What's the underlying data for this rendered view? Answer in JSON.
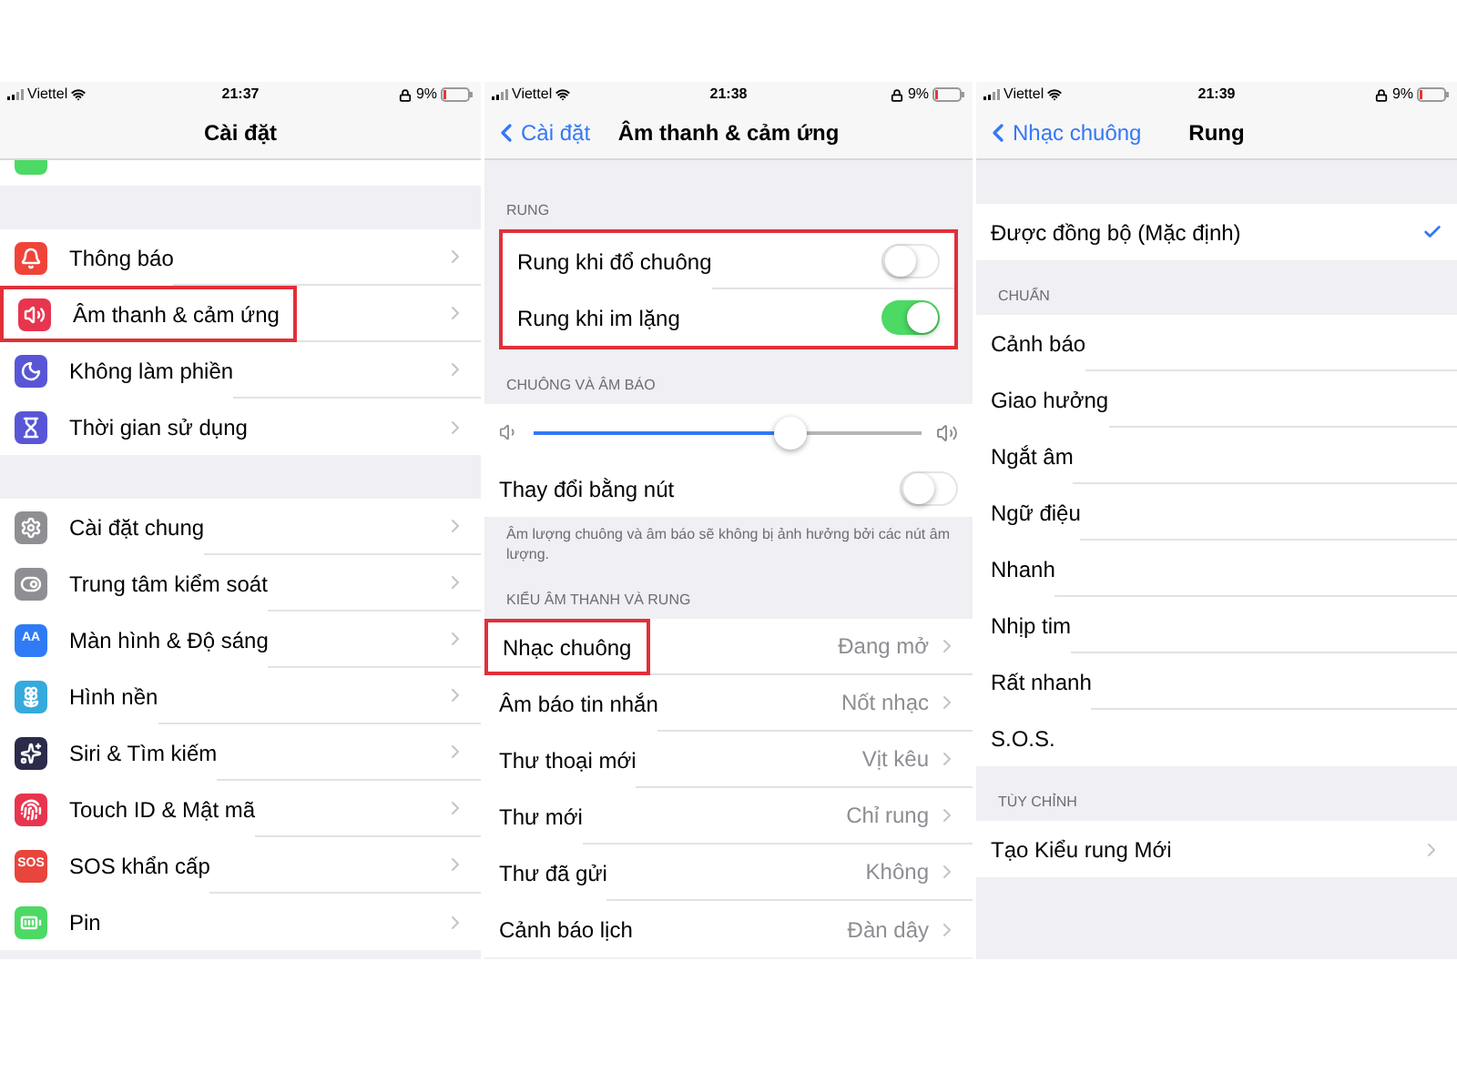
{
  "screens": [
    {
      "kind": "settings",
      "status_bar": {
        "carrier": "Viettel",
        "time": "21:37",
        "battery": "9%"
      },
      "nav": {
        "title": "Cài đặt"
      },
      "groups": [
        {
          "rows": [
            {
              "kind": "cut",
              "color": "#4cd964"
            }
          ]
        },
        {
          "rows": [
            {
              "kind": "link",
              "label": "Thông báo",
              "color": "#f0443a",
              "highlighted": false
            },
            {
              "kind": "link",
              "label": "Âm thanh & cảm ứng",
              "color": "#e8354f",
              "highlighted": true
            },
            {
              "kind": "link",
              "label": "Không làm phiền",
              "color": "#5856d6",
              "highlighted": false
            },
            {
              "kind": "link",
              "label": "Thời gian sử dụng",
              "color": "#5856d6",
              "highlighted": false
            }
          ]
        },
        {
          "rows": [
            {
              "kind": "link",
              "label": "Cài đặt chung",
              "color": "#8e8e93"
            },
            {
              "kind": "link",
              "label": "Trung tâm kiểm soát",
              "color": "#8e8e93"
            },
            {
              "kind": "link",
              "label": "Màn hình & Độ sáng",
              "color": "#2f7bf5",
              "icon_text": "AA"
            },
            {
              "kind": "link",
              "label": "Hình nền",
              "color": "#35aadc"
            },
            {
              "kind": "link",
              "label": "Siri & Tìm kiếm",
              "color": "#2b2b4a"
            },
            {
              "kind": "link",
              "label": "Touch ID & Mật mã",
              "color": "#e8354f"
            },
            {
              "kind": "link",
              "label": "SOS khẩn cấp",
              "color": "#e8453c",
              "icon_text": "SOS"
            },
            {
              "kind": "link",
              "label": "Pin",
              "color": "#4cd964"
            }
          ]
        }
      ]
    },
    {
      "kind": "detail",
      "status_bar": {
        "carrier": "Viettel",
        "time": "21:38",
        "battery": "9%"
      },
      "nav": {
        "back": "Cài đặt",
        "title": "Âm thanh & cảm ứng"
      },
      "groups": [
        {
          "header": "RUNG",
          "highlighted": true,
          "rows": [
            {
              "kind": "toggle",
              "label": "Rung khi đổ chuông",
              "on": false
            },
            {
              "kind": "toggle",
              "label": "Rung khi im lặng",
              "on": true
            }
          ]
        },
        {
          "header": "CHUÔNG VÀ ÂM BÁO",
          "footer": "Âm lượng chuông và âm báo sẽ không bị ảnh hưởng bởi các nút âm lượng.",
          "rows": [
            {
              "kind": "slider",
              "level": 0.66
            },
            {
              "kind": "toggle",
              "label": "Thay đổi bằng nút",
              "on": false
            }
          ]
        },
        {
          "header": "KIỂU ÂM THANH VÀ RUNG",
          "rows": [
            {
              "kind": "link",
              "label": "Nhạc chuông",
              "value": "Đang mở",
              "highlighted": true
            },
            {
              "kind": "link",
              "label": "Âm báo tin nhắn",
              "value": "Nốt nhạc",
              "highlighted": false
            },
            {
              "kind": "link",
              "label": "Thư thoại mới",
              "value": "Vịt kêu",
              "highlighted": false
            },
            {
              "kind": "link",
              "label": "Thư mới",
              "value": "Chỉ rung",
              "highlighted": false
            },
            {
              "kind": "link",
              "label": "Thư đã gửi",
              "value": "Không",
              "highlighted": false
            },
            {
              "kind": "link",
              "label": "Cảnh báo lịch",
              "value": "Đàn dây",
              "highlighted": false
            }
          ]
        }
      ]
    },
    {
      "kind": "detail",
      "status_bar": {
        "carrier": "Viettel",
        "time": "21:39",
        "battery": "9%"
      },
      "nav": {
        "back": "Nhạc chuông",
        "title": "Rung"
      },
      "groups": [
        {
          "rows": [
            {
              "kind": "option",
              "label": "Được đồng bộ (Mặc định)",
              "selected": true
            }
          ]
        },
        {
          "header": "CHUẨN",
          "rows": [
            {
              "kind": "option",
              "label": "Cảnh báo",
              "selected": false
            },
            {
              "kind": "option",
              "label": "Giao hưởng",
              "selected": false
            },
            {
              "kind": "option",
              "label": "Ngắt âm",
              "selected": false
            },
            {
              "kind": "option",
              "label": "Ngữ điệu",
              "selected": false
            },
            {
              "kind": "option",
              "label": "Nhanh",
              "selected": false
            },
            {
              "kind": "option",
              "label": "Nhịp tim",
              "selected": false
            },
            {
              "kind": "option",
              "label": "Rất nhanh",
              "selected": false
            },
            {
              "kind": "option",
              "label": "S.O.S.",
              "selected": false
            }
          ]
        },
        {
          "header": "TÙY CHỈNH",
          "rows": [
            {
              "kind": "link",
              "label": "Tạo Kiểu rung Mới"
            }
          ]
        }
      ]
    }
  ]
}
